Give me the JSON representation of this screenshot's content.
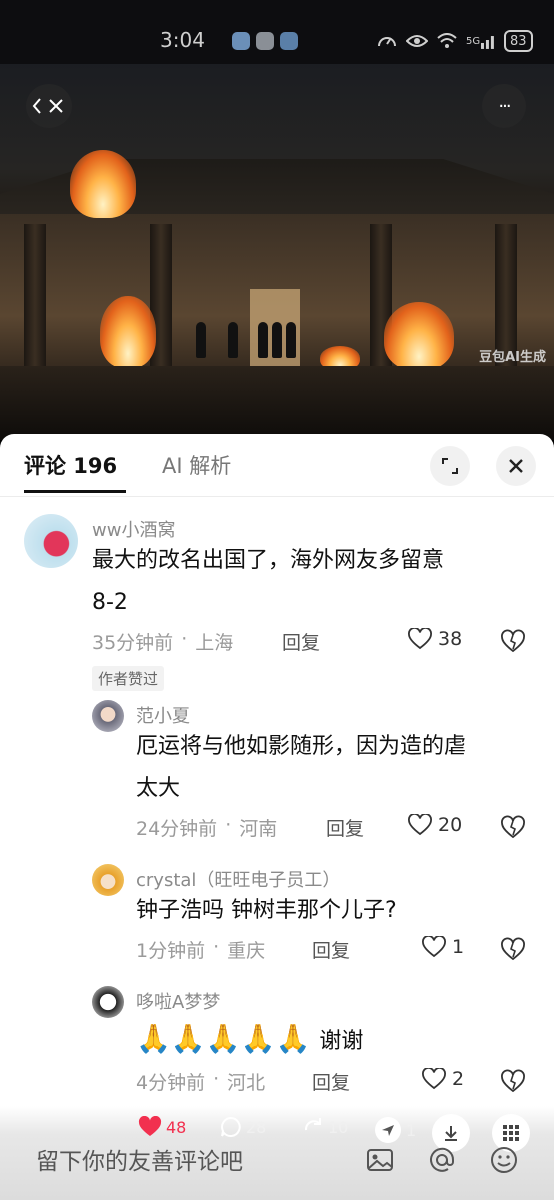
{
  "status_bar": {
    "time": "3:04",
    "battery": "83",
    "network": "5G"
  },
  "video": {
    "watermark": "豆包AI生成",
    "more_label": "···"
  },
  "comments_panel": {
    "tab_comments": "评论 196",
    "tab_ai": "AI 解析"
  },
  "comments": [
    {
      "user": "ww小酒窝",
      "text_line1": "最大的改名出国了，海外网友多留意",
      "text_line2": "8-2",
      "time": "35分钟前",
      "location": "上海",
      "reply": "回复",
      "likes": "38",
      "badge": "作者赞过"
    },
    {
      "user": "范小夏",
      "text_line1": "厄运将与他如影随形，因为造的虐",
      "text_line2": "太大",
      "time": "24分钟前",
      "location": "河南",
      "reply": "回复",
      "likes": "20"
    },
    {
      "user": "crystal（旺旺电子员工）",
      "text_line1": "钟子浩吗 钟树丰那个儿子?",
      "time": "1分钟前",
      "location": "重庆",
      "reply": "回复",
      "likes": "1"
    },
    {
      "user": "哆啦A梦梦",
      "emojis": "🙏🙏🙏🙏🙏",
      "text_line1": "谢谢",
      "time": "4分钟前",
      "location": "河北",
      "reply": "回复",
      "likes": "2"
    }
  ],
  "bottom_bar": {
    "input_placeholder": "留下你的友善评论吧",
    "likes": "48",
    "comments": "28",
    "shares": "10",
    "forwards": "1"
  },
  "colors": {
    "like_red": "#f2304f",
    "text_dark": "#111111",
    "text_grey": "#9a9a9a"
  }
}
